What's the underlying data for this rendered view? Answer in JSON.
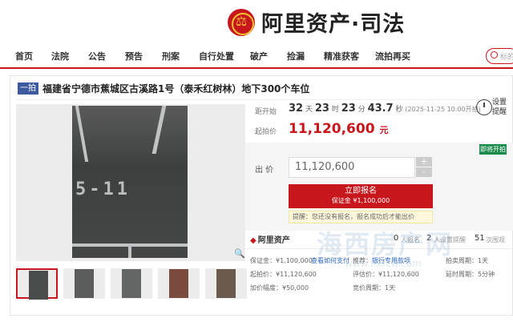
{
  "brand": {
    "title": "阿里资产·司法",
    "emblem_icon": "court-emblem-icon",
    "accent": "#c8161d"
  },
  "nav": {
    "items": [
      "首页",
      "法院",
      "公告",
      "预告",
      "刑案",
      "自行处置",
      "破产",
      "捡漏",
      "精准获客",
      "流拍再买"
    ],
    "search_placeholder": "标的"
  },
  "item": {
    "badge": "一拍",
    "title": "福建省宁德市蕉城区古溪路1号（泰禾红树林）地下300个车位",
    "photo_text": "5-11"
  },
  "auction": {
    "countdown_label": "距开始",
    "days": "32",
    "days_unit": "天",
    "hours": "23",
    "hours_unit": "时",
    "minutes": "23",
    "minutes_unit": "分",
    "seconds": "43.7",
    "seconds_unit": "秒",
    "start_time": "(2025-11-25 10:00开拍)",
    "remind_label": "设置提醒",
    "start_price_label": "起拍价",
    "start_price": "11,120,600",
    "currency": "元",
    "status_tag": "即将开拍",
    "bid_label": "出 价",
    "bid_value": "11,120,600",
    "plus": "+",
    "minus": "-",
    "signup_label": "立即报名",
    "signup_deposit": "保证金 ¥1,100,000",
    "hint": "提醒：您还没有报名，报名成功后才能出价"
  },
  "stats": {
    "logo": "阿里资产",
    "signups": "0",
    "signups_label": "人报名",
    "reminders": "2",
    "reminders_label": "人设置提醒",
    "views": "51",
    "views_label": "次围观"
  },
  "details": {
    "deposit": "保证金：¥1,100,000",
    "how_to_pay": "查看如何支付",
    "recommend": "推荐：",
    "loan_link": "银行专用款项",
    "delay_cycle": "延时周期：5分钟",
    "start_price": "起拍价：¥11,120,600",
    "appraisal": "评估价：¥11,120,600",
    "auction_cycle": "拍卖周期：1天",
    "increment": "加价幅度：¥50,000",
    "bid_period": "竞价周期：1天"
  },
  "watermark": {
    "text": "海西房产网",
    "url": "www.hxfcw.com"
  }
}
